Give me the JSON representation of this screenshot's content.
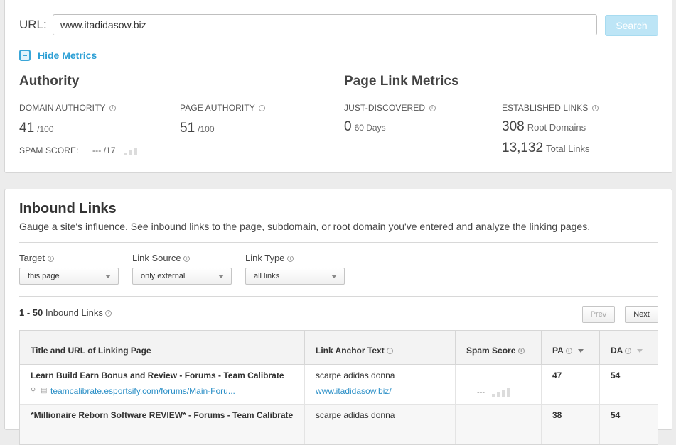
{
  "search": {
    "url_label": "URL:",
    "url_value": "www.itadidasow.biz",
    "search_button": "Search"
  },
  "metrics_toggle": "Hide Metrics",
  "authority": {
    "title": "Authority",
    "domain_authority_label": "DOMAIN AUTHORITY",
    "domain_authority_value": "41",
    "domain_authority_max": "/100",
    "page_authority_label": "PAGE AUTHORITY",
    "page_authority_value": "51",
    "page_authority_max": "/100",
    "spam_score_label": "SPAM SCORE:",
    "spam_score_value": "--- /17"
  },
  "page_link_metrics": {
    "title": "Page Link Metrics",
    "just_discovered_label": "JUST-DISCOVERED",
    "just_discovered_value": "0",
    "just_discovered_sub": "60 Days",
    "established_label": "ESTABLISHED LINKS",
    "root_domains_value": "308",
    "root_domains_sub": "Root Domains",
    "total_links_value": "13,132",
    "total_links_sub": "Total Links"
  },
  "inbound": {
    "title": "Inbound Links",
    "description": "Gauge a site's influence. See inbound links to the page, subdomain, or root domain you've entered and analyze the linking pages.",
    "filters": {
      "target_label": "Target",
      "target_value": "this page",
      "source_label": "Link Source",
      "source_value": "only external",
      "type_label": "Link Type",
      "type_value": "all links"
    },
    "count_range": "1 - 50",
    "count_text": "Inbound Links",
    "prev_label": "Prev",
    "next_label": "Next",
    "columns": {
      "title_url": "Title and URL of Linking Page",
      "anchor": "Link Anchor Text",
      "spam": "Spam Score",
      "pa": "PA",
      "da": "DA"
    },
    "rows": [
      {
        "title": "Learn Build Earn Bonus and Review - Forums - Team Calibrate",
        "url": "teamcalibrate.esportsify.com/forums/Main-Foru...",
        "anchor_text": "scarpe adidas donna",
        "anchor_url": "www.itadidasow.biz/",
        "spam": "---",
        "pa": "47",
        "da": "54"
      },
      {
        "title": "*Millionaire Reborn Software REVIEW* - Forums - Team Calibrate",
        "url": "",
        "anchor_text": "scarpe adidas donna",
        "anchor_url": "",
        "spam": "",
        "pa": "38",
        "da": "54"
      }
    ]
  }
}
